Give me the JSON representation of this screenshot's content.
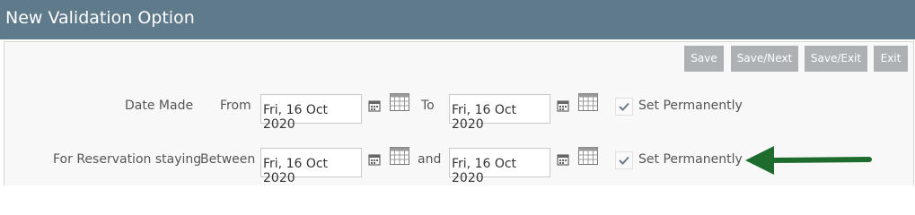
{
  "window": {
    "title": "New Validation Option"
  },
  "toolbar": {
    "save": "Save",
    "save_next": "Save/Next",
    "save_exit": "Save/Exit",
    "exit": "Exit"
  },
  "rows": [
    {
      "label": "Date Made",
      "from_label": "From",
      "from_value": "Fri, 16 Oct 2020",
      "to_label": "To",
      "to_value": "Fri, 16 Oct 2020",
      "checkbox_label": "Set Permanently",
      "checked": true
    },
    {
      "label": "For Reservation staying",
      "from_label": "Between",
      "from_value": "Fri, 16 Oct 2020",
      "to_label": "and",
      "to_value": "Fri, 16 Oct 2020",
      "checkbox_label": "Set Permanently",
      "checked": true
    }
  ],
  "icons": {
    "calendar_small": "calendar-small-icon",
    "calendar_grid": "calendar-grid-icon",
    "check": "check-icon",
    "annotation_arrow": "arrow-left-icon"
  },
  "colors": {
    "titlebar": "#5f7a8a",
    "button": "#aeb1b3",
    "arrow": "#1e6b2e"
  }
}
